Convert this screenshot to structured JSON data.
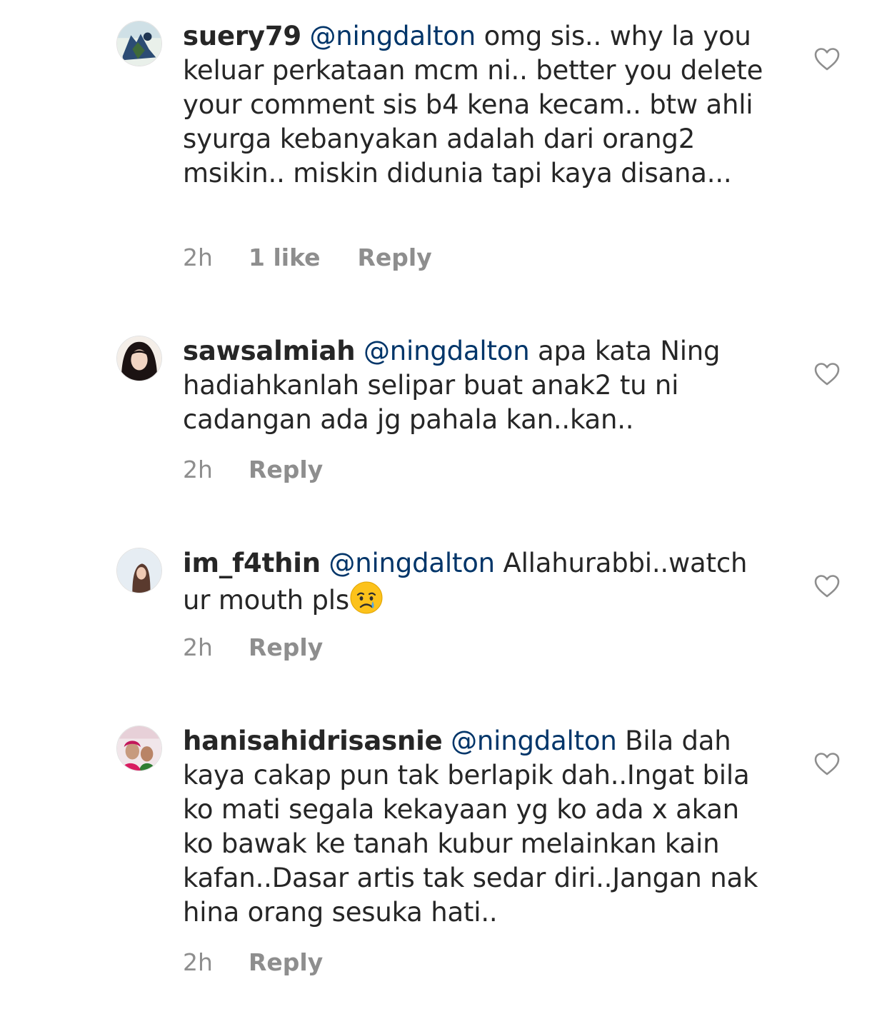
{
  "comments": [
    {
      "username": "suery79",
      "mention": "@ningdalton",
      "text": "omg sis.. why la you keluar perkataan mcm ni.. better you delete your comment sis b4 kena kecam.. btw ahli syurga kebanyakan adalah dari orang2 msikin.. miskin didunia tapi kaya disana...",
      "time": "2h",
      "likes": "1 like",
      "reply": "Reply"
    },
    {
      "username": "sawsalmiah",
      "mention": "@ningdalton",
      "text": "apa kata Ning hadiahkanlah selipar buat anak2 tu ni cadangan ada jg pahala kan..kan..",
      "time": "2h",
      "reply": "Reply"
    },
    {
      "username": "im_f4thin",
      "mention": "@ningdalton",
      "text": "Allahurabbi..watch ur mouth pls",
      "emoji": "crying-face",
      "time": "2h",
      "reply": "Reply"
    },
    {
      "username": "hanisahidrisasnie",
      "mention": "@ningdalton",
      "text": "Bila dah kaya cakap pun tak berlapik dah..Ingat bila ko mati segala kekayaan yg ko ada x akan ko  bawak ke tanah kubur melainkan kain kafan..Dasar artis tak sedar diri..Jangan nak hina orang sesuka hati..",
      "time": "2h",
      "reply": "Reply"
    }
  ],
  "icons": {
    "heart": "heart-outline-icon",
    "emoji": "crying-face-emoji"
  },
  "colors": {
    "text": "#262626",
    "mention": "#003569",
    "meta": "#8e8e8e",
    "heart_stroke": "#8e8e8e"
  }
}
